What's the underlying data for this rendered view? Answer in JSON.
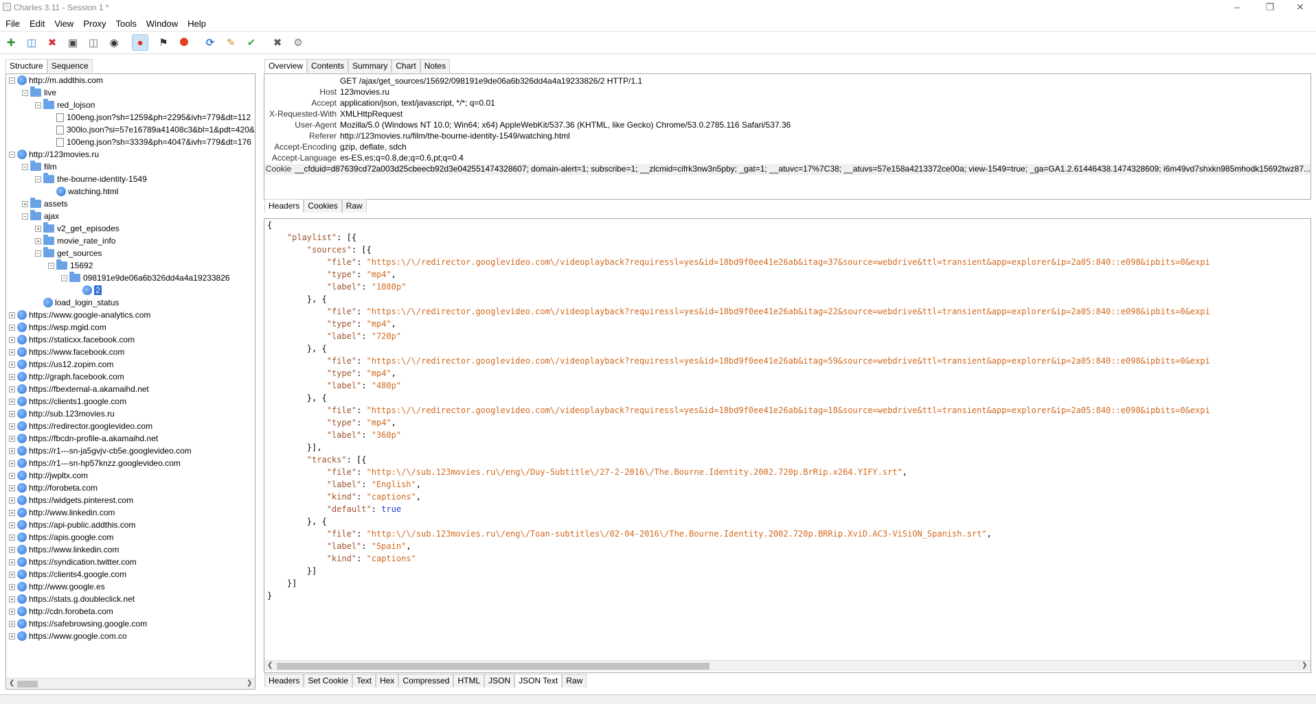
{
  "window": {
    "title": "Charles 3.11 - Session 1 *"
  },
  "menu": [
    "File",
    "Edit",
    "View",
    "Proxy",
    "Tools",
    "Window",
    "Help"
  ],
  "toolbar": {
    "icons": [
      "new-session-icon",
      "open-session-icon",
      "close-session-icon",
      "save-icon",
      "clear-icon",
      "find-icon",
      "record-icon",
      "throttle-icon",
      "breakpoints-icon",
      "repeat-icon",
      "edit-icon",
      "validate-icon",
      "tools-icon",
      "settings-icon"
    ],
    "colors": {
      "record": "#e03030",
      "breakpoint": "#e04020",
      "repeat": "#2a7ad5",
      "validate": "#3caa3c"
    }
  },
  "left_tabs": [
    "Structure",
    "Sequence"
  ],
  "tree": [
    {
      "label": "http://m.addthis.com",
      "type": "host",
      "depth": 0,
      "expanded": true
    },
    {
      "label": "live",
      "type": "folder",
      "depth": 1,
      "expanded": true
    },
    {
      "label": "red_lojson",
      "type": "folder",
      "depth": 2,
      "expanded": true
    },
    {
      "label": "100eng.json?sh=1259&ph=2295&ivh=779&dt=112",
      "type": "file",
      "depth": 3
    },
    {
      "label": "300lo.json?si=57e16789a41408c3&bl=1&pdt=420&",
      "type": "file",
      "depth": 3
    },
    {
      "label": "100eng.json?sh=3339&ph=4047&ivh=779&dt=176",
      "type": "file",
      "depth": 3
    },
    {
      "label": "http://123movies.ru",
      "type": "host",
      "depth": 0,
      "expanded": true
    },
    {
      "label": "film",
      "type": "folder",
      "depth": 1,
      "expanded": true
    },
    {
      "label": "the-bourne-identity-1549",
      "type": "folder",
      "depth": 2,
      "expanded": true
    },
    {
      "label": "watching.html",
      "type": "globe",
      "depth": 3
    },
    {
      "label": "assets",
      "type": "folder",
      "depth": 1,
      "expanded": false
    },
    {
      "label": "ajax",
      "type": "folder",
      "depth": 1,
      "expanded": true
    },
    {
      "label": "v2_get_episodes",
      "type": "folder",
      "depth": 2,
      "expanded": false
    },
    {
      "label": "movie_rate_info",
      "type": "folder",
      "depth": 2,
      "expanded": false
    },
    {
      "label": "get_sources",
      "type": "folder",
      "depth": 2,
      "expanded": true
    },
    {
      "label": "15692",
      "type": "folder",
      "depth": 3,
      "expanded": true
    },
    {
      "label": "098191e9de06a6b326dd4a4a19233826",
      "type": "folder",
      "depth": 4,
      "expanded": true
    },
    {
      "label": "2",
      "type": "globe",
      "depth": 5,
      "selected": true
    },
    {
      "label": "load_login_status",
      "type": "globe",
      "depth": 2
    },
    {
      "label": "https://www.google-analytics.com",
      "type": "host",
      "depth": 0
    },
    {
      "label": "https://wsp.mgid.com",
      "type": "host",
      "depth": 0
    },
    {
      "label": "https://staticxx.facebook.com",
      "type": "host",
      "depth": 0
    },
    {
      "label": "https://www.facebook.com",
      "type": "host",
      "depth": 0
    },
    {
      "label": "https://us12.zopim.com",
      "type": "host",
      "depth": 0
    },
    {
      "label": "http://graph.facebook.com",
      "type": "host",
      "depth": 0
    },
    {
      "label": "https://fbexternal-a.akamaihd.net",
      "type": "host",
      "depth": 0
    },
    {
      "label": "https://clients1.google.com",
      "type": "host",
      "depth": 0
    },
    {
      "label": "http://sub.123movies.ru",
      "type": "host",
      "depth": 0
    },
    {
      "label": "https://redirector.googlevideo.com",
      "type": "host",
      "depth": 0
    },
    {
      "label": "https://fbcdn-profile-a.akamaihd.net",
      "type": "host",
      "depth": 0
    },
    {
      "label": "https://r1---sn-ja5gvjv-cb5e.googlevideo.com",
      "type": "host",
      "depth": 0
    },
    {
      "label": "https://r1---sn-hp57knzz.googlevideo.com",
      "type": "host",
      "depth": 0
    },
    {
      "label": "http://jwpltx.com",
      "type": "host",
      "depth": 0
    },
    {
      "label": "http://forobeta.com",
      "type": "host",
      "depth": 0
    },
    {
      "label": "https://widgets.pinterest.com",
      "type": "host",
      "depth": 0
    },
    {
      "label": "http://www.linkedin.com",
      "type": "host",
      "depth": 0
    },
    {
      "label": "https://api-public.addthis.com",
      "type": "host",
      "depth": 0
    },
    {
      "label": "https://apis.google.com",
      "type": "host",
      "depth": 0
    },
    {
      "label": "https://www.linkedin.com",
      "type": "host",
      "depth": 0
    },
    {
      "label": "https://syndication.twitter.com",
      "type": "host",
      "depth": 0
    },
    {
      "label": "https://clients4.google.com",
      "type": "host",
      "depth": 0
    },
    {
      "label": "http://www.google.es",
      "type": "host",
      "depth": 0
    },
    {
      "label": "https://stats.g.doubleclick.net",
      "type": "host",
      "depth": 0
    },
    {
      "label": "http://cdn.forobeta.com",
      "type": "host",
      "depth": 0
    },
    {
      "label": "https://safebrowsing.google.com",
      "type": "host",
      "depth": 0
    },
    {
      "label": "https://www.google.com.co",
      "type": "host",
      "depth": 0
    }
  ],
  "right_tabs": [
    "Overview",
    "Contents",
    "Summary",
    "Chart",
    "Notes"
  ],
  "request_headers": [
    {
      "key": "",
      "value": "GET /ajax/get_sources/15692/098191e9de06a6b326dd4a4a19233826/2 HTTP/1.1"
    },
    {
      "key": "Host",
      "value": "123movies.ru"
    },
    {
      "key": "Accept",
      "value": "application/json, text/javascript, */*; q=0.01"
    },
    {
      "key": "X-Requested-With",
      "value": "XMLHttpRequest"
    },
    {
      "key": "User-Agent",
      "value": "Mozilla/5.0 (Windows NT 10.0; Win64; x64) AppleWebKit/537.36 (KHTML, like Gecko) Chrome/53.0.2785.116 Safari/537.36"
    },
    {
      "key": "Referer",
      "value": "http://123movies.ru/film/the-bourne-identity-1549/watching.html"
    },
    {
      "key": "Accept-Encoding",
      "value": "gzip, deflate, sdch"
    },
    {
      "key": "Accept-Language",
      "value": "es-ES,es;q=0.8,de;q=0.6,pt;q=0.4"
    },
    {
      "key": "Cookie",
      "value": "__cfduid=d87639cd72a003d25cbeecb92d3e042551474328607; domain-alert=1; subscribe=1; __zlcmid=cifrk3nw3n5pby; _gat=1; __atuvc=17%7C38; __atuvs=57e158a4213372ce00a; view-1549=true; _ga=GA1.2.61446438.1474328609; i6m49vd7shxkn985mhodk15692twz87..."
    }
  ],
  "request_subtabs": [
    "Headers",
    "Cookies",
    "Raw"
  ],
  "json_lines": [
    [
      {
        "t": "p",
        "v": "{"
      }
    ],
    [
      {
        "t": "p",
        "v": "    "
      },
      {
        "t": "k",
        "v": "\"playlist\""
      },
      {
        "t": "p",
        "v": ": [{"
      }
    ],
    [
      {
        "t": "p",
        "v": "        "
      },
      {
        "t": "k",
        "v": "\"sources\""
      },
      {
        "t": "p",
        "v": ": [{"
      }
    ],
    [
      {
        "t": "p",
        "v": "            "
      },
      {
        "t": "k",
        "v": "\"file\""
      },
      {
        "t": "p",
        "v": ": "
      },
      {
        "t": "s",
        "v": "\"https:\\/\\/redirector.googlevideo.com\\/videoplayback?requiressl=yes&id=18bd9f0ee41e26ab&itag=37&source=webdrive&ttl=transient&app=explorer&ip=2a05:840::e098&ipbits=0&expi"
      }
    ],
    [
      {
        "t": "p",
        "v": "            "
      },
      {
        "t": "k",
        "v": "\"type\""
      },
      {
        "t": "p",
        "v": ": "
      },
      {
        "t": "s",
        "v": "\"mp4\""
      },
      {
        "t": "p",
        "v": ","
      }
    ],
    [
      {
        "t": "p",
        "v": "            "
      },
      {
        "t": "k",
        "v": "\"label\""
      },
      {
        "t": "p",
        "v": ": "
      },
      {
        "t": "s",
        "v": "\"1080p\""
      }
    ],
    [
      {
        "t": "p",
        "v": "        }, {"
      }
    ],
    [
      {
        "t": "p",
        "v": "            "
      },
      {
        "t": "k",
        "v": "\"file\""
      },
      {
        "t": "p",
        "v": ": "
      },
      {
        "t": "s",
        "v": "\"https:\\/\\/redirector.googlevideo.com\\/videoplayback?requiressl=yes&id=18bd9f0ee41e26ab&itag=22&source=webdrive&ttl=transient&app=explorer&ip=2a05:840::e098&ipbits=0&expi"
      }
    ],
    [
      {
        "t": "p",
        "v": "            "
      },
      {
        "t": "k",
        "v": "\"type\""
      },
      {
        "t": "p",
        "v": ": "
      },
      {
        "t": "s",
        "v": "\"mp4\""
      },
      {
        "t": "p",
        "v": ","
      }
    ],
    [
      {
        "t": "p",
        "v": "            "
      },
      {
        "t": "k",
        "v": "\"label\""
      },
      {
        "t": "p",
        "v": ": "
      },
      {
        "t": "s",
        "v": "\"720p\""
      }
    ],
    [
      {
        "t": "p",
        "v": "        }, {"
      }
    ],
    [
      {
        "t": "p",
        "v": "            "
      },
      {
        "t": "k",
        "v": "\"file\""
      },
      {
        "t": "p",
        "v": ": "
      },
      {
        "t": "s",
        "v": "\"https:\\/\\/redirector.googlevideo.com\\/videoplayback?requiressl=yes&id=18bd9f0ee41e26ab&itag=59&source=webdrive&ttl=transient&app=explorer&ip=2a05:840::e098&ipbits=0&expi"
      }
    ],
    [
      {
        "t": "p",
        "v": "            "
      },
      {
        "t": "k",
        "v": "\"type\""
      },
      {
        "t": "p",
        "v": ": "
      },
      {
        "t": "s",
        "v": "\"mp4\""
      },
      {
        "t": "p",
        "v": ","
      }
    ],
    [
      {
        "t": "p",
        "v": "            "
      },
      {
        "t": "k",
        "v": "\"label\""
      },
      {
        "t": "p",
        "v": ": "
      },
      {
        "t": "s",
        "v": "\"480p\""
      }
    ],
    [
      {
        "t": "p",
        "v": "        }, {"
      }
    ],
    [
      {
        "t": "p",
        "v": "            "
      },
      {
        "t": "k",
        "v": "\"file\""
      },
      {
        "t": "p",
        "v": ": "
      },
      {
        "t": "s",
        "v": "\"https:\\/\\/redirector.googlevideo.com\\/videoplayback?requiressl=yes&id=18bd9f0ee41e26ab&itag=18&source=webdrive&ttl=transient&app=explorer&ip=2a05:840::e098&ipbits=0&expi"
      }
    ],
    [
      {
        "t": "p",
        "v": "            "
      },
      {
        "t": "k",
        "v": "\"type\""
      },
      {
        "t": "p",
        "v": ": "
      },
      {
        "t": "s",
        "v": "\"mp4\""
      },
      {
        "t": "p",
        "v": ","
      }
    ],
    [
      {
        "t": "p",
        "v": "            "
      },
      {
        "t": "k",
        "v": "\"label\""
      },
      {
        "t": "p",
        "v": ": "
      },
      {
        "t": "s",
        "v": "\"360p\""
      }
    ],
    [
      {
        "t": "p",
        "v": "        }],"
      }
    ],
    [
      {
        "t": "p",
        "v": "        "
      },
      {
        "t": "k",
        "v": "\"tracks\""
      },
      {
        "t": "p",
        "v": ": [{"
      }
    ],
    [
      {
        "t": "p",
        "v": "            "
      },
      {
        "t": "k",
        "v": "\"file\""
      },
      {
        "t": "p",
        "v": ": "
      },
      {
        "t": "s",
        "v": "\"http:\\/\\/sub.123movies.ru\\/eng\\/Duy-Subtitle\\/27-2-2016\\/The.Bourne.Identity.2002.720p.BrRip.x264.YIFY.srt\""
      },
      {
        "t": "p",
        "v": ","
      }
    ],
    [
      {
        "t": "p",
        "v": "            "
      },
      {
        "t": "k",
        "v": "\"label\""
      },
      {
        "t": "p",
        "v": ": "
      },
      {
        "t": "s",
        "v": "\"English\""
      },
      {
        "t": "p",
        "v": ","
      }
    ],
    [
      {
        "t": "p",
        "v": "            "
      },
      {
        "t": "k",
        "v": "\"kind\""
      },
      {
        "t": "p",
        "v": ": "
      },
      {
        "t": "s",
        "v": "\"captions\""
      },
      {
        "t": "p",
        "v": ","
      }
    ],
    [
      {
        "t": "p",
        "v": "            "
      },
      {
        "t": "k",
        "v": "\"default\""
      },
      {
        "t": "p",
        "v": ": "
      },
      {
        "t": "b",
        "v": "true"
      }
    ],
    [
      {
        "t": "p",
        "v": "        }, {"
      }
    ],
    [
      {
        "t": "p",
        "v": "            "
      },
      {
        "t": "k",
        "v": "\"file\""
      },
      {
        "t": "p",
        "v": ": "
      },
      {
        "t": "s",
        "v": "\"http:\\/\\/sub.123movies.ru\\/eng\\/Toan-subtitles\\/02-04-2016\\/The.Bourne.Identity.2002.720p.BRRip.XviD.AC3-ViSiON_Spanish.srt\""
      },
      {
        "t": "p",
        "v": ","
      }
    ],
    [
      {
        "t": "p",
        "v": "            "
      },
      {
        "t": "k",
        "v": "\"label\""
      },
      {
        "t": "p",
        "v": ": "
      },
      {
        "t": "s",
        "v": "\"Spain\""
      },
      {
        "t": "p",
        "v": ","
      }
    ],
    [
      {
        "t": "p",
        "v": "            "
      },
      {
        "t": "k",
        "v": "\"kind\""
      },
      {
        "t": "p",
        "v": ": "
      },
      {
        "t": "s",
        "v": "\"captions\""
      }
    ],
    [
      {
        "t": "p",
        "v": "        }]"
      }
    ],
    [
      {
        "t": "p",
        "v": "    }]"
      }
    ],
    [
      {
        "t": "p",
        "v": "}"
      }
    ]
  ],
  "response_tabs": [
    "Headers",
    "Set Cookie",
    "Text",
    "Hex",
    "Compressed",
    "HTML",
    "JSON",
    "JSON Text",
    "Raw"
  ],
  "selected": {
    "left_tab": "Structure",
    "right_tab": "Overview",
    "request_subtab": "Headers",
    "response_tab": "JSON Text"
  }
}
